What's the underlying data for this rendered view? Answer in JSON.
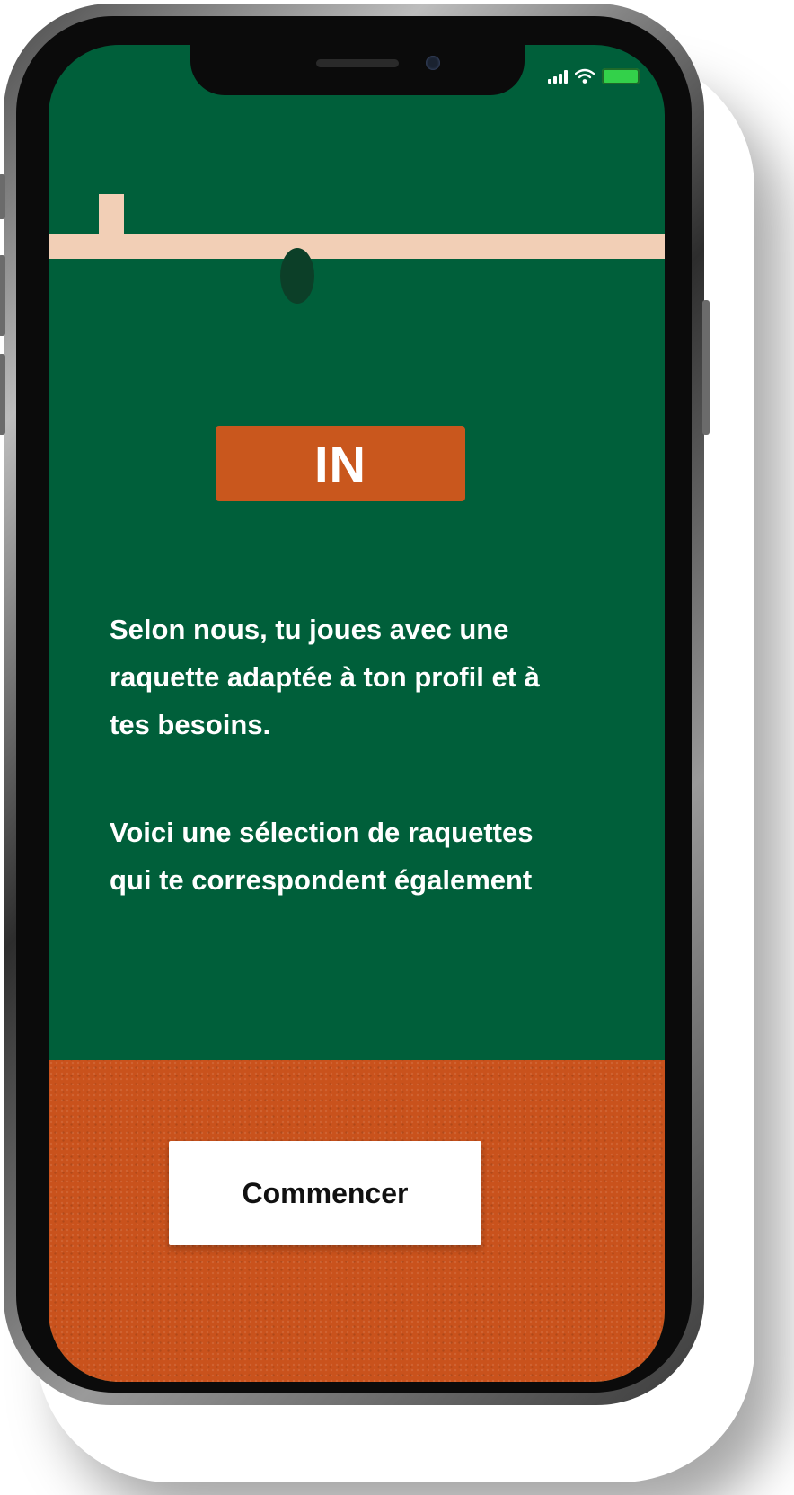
{
  "status_bar": {
    "signal_icon": "cellular-signal-icon",
    "wifi_icon": "wifi-icon",
    "battery_icon": "battery-icon",
    "battery_color": "#33d14a"
  },
  "colors": {
    "court_green": "#005f3a",
    "court_line": "#f2cfb6",
    "clay": "#c9521c",
    "verdict_bg": "#c9571d",
    "button_bg": "#ffffff"
  },
  "verdict": {
    "label": "IN"
  },
  "messages": {
    "line1": "Selon nous, tu joues avec une raquette adaptée à ton profil et à tes besoins.",
    "line2": "Voici une sélection de raquettes qui te correspondent également"
  },
  "actions": {
    "start_label": "Commencer"
  }
}
